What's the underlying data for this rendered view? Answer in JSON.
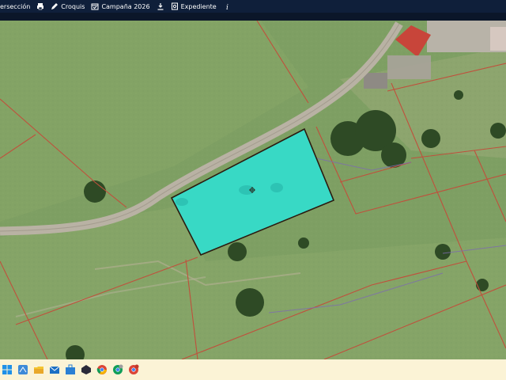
{
  "toolbar": {
    "items": [
      {
        "label": "ersección",
        "icon": "print-icon"
      },
      {
        "label": "Croquis",
        "icon": "pencil-icon"
      },
      {
        "label": "Campaña 2026",
        "icon": "calendar-icon"
      },
      {
        "label": "Expediente",
        "icon": "download-icon"
      },
      {
        "label": "",
        "icon": "document-icon"
      },
      {
        "label": "",
        "icon": "info-icon"
      }
    ]
  },
  "map": {
    "base": "aerial-orthophoto",
    "parcel_fill": "#2ce3d6",
    "parcel_outline": "#2b1b10",
    "cadastral_lines": "#c0503c"
  },
  "taskbar": {
    "icons": [
      "windows-icon",
      "task-view-icon",
      "file-explorer-icon",
      "mail-icon",
      "store-icon",
      "app-icon",
      "chrome-icon",
      "chrome-profile-icon",
      "chrome-profile-2-icon"
    ]
  }
}
